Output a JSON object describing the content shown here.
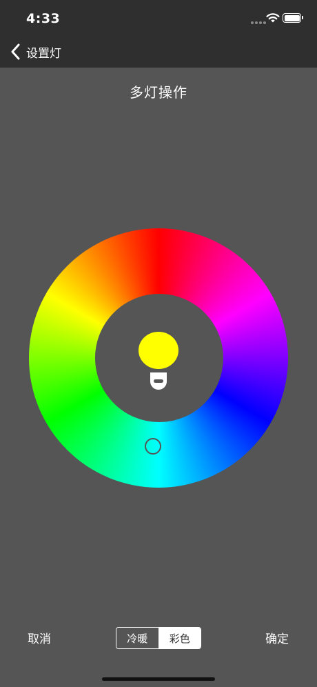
{
  "status_bar": {
    "time": "4:33",
    "icons": [
      "cellular-signal-icon",
      "wifi-icon",
      "battery-icon"
    ]
  },
  "nav": {
    "back_label": "设置灯",
    "back_icon": "chevron-left-icon"
  },
  "page": {
    "title": "多灯操作"
  },
  "color_wheel": {
    "bulb_color": "#ffff00",
    "selected_color": "#00ffff"
  },
  "footer": {
    "cancel_label": "取消",
    "confirm_label": "确定",
    "mode_options": [
      "冷暖",
      "彩色"
    ],
    "selected_mode": "彩色"
  },
  "colors": {
    "background": "#555555",
    "bar": "#2f2f2f",
    "text": "#ffffff"
  }
}
